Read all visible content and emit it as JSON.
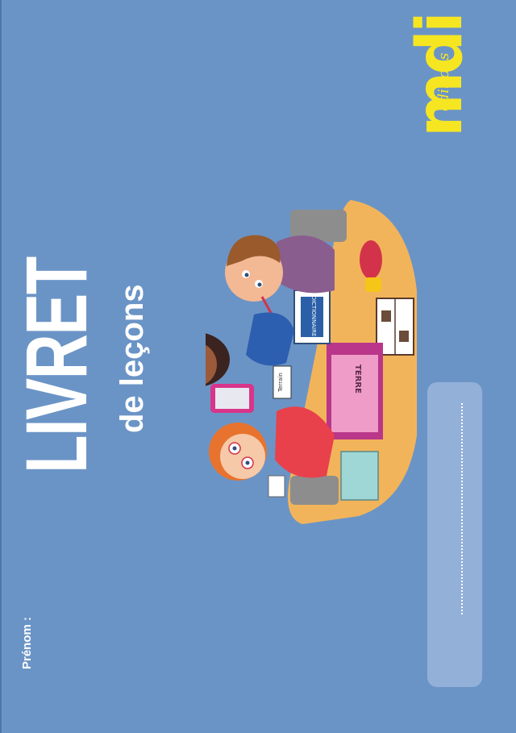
{
  "publisher": {
    "brand": "mdi",
    "prefix": "éditions"
  },
  "title": {
    "main": "LIVRET",
    "sub": "de leçons"
  },
  "illustration": {
    "dictionary_label": "DICTIONNAIRE",
    "word_cards": [
      "Terrain",
      "TERRE"
    ]
  },
  "name_field": {
    "label": "Prénom :"
  },
  "colors": {
    "background": "#6b94c6",
    "logo": "#f6e622",
    "panel": "#93b0d9",
    "text": "#ffffff"
  }
}
